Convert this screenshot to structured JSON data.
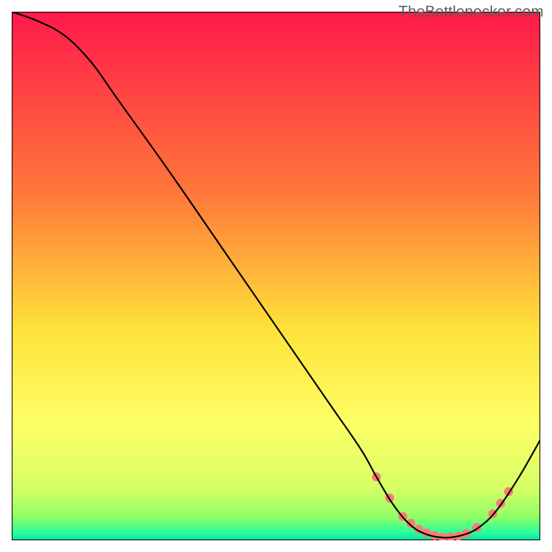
{
  "watermark": "TheBottlenecker.com",
  "chart_data": {
    "type": "line",
    "title": "",
    "xlabel": "",
    "ylabel": "",
    "xlim": [
      0,
      100
    ],
    "ylim": [
      0,
      100
    ],
    "grid": false,
    "legend": false,
    "background_gradient_stops": [
      {
        "offset": 0.0,
        "color": "#ff1a4b"
      },
      {
        "offset": 0.35,
        "color": "#ff7a3a"
      },
      {
        "offset": 0.6,
        "color": "#ffe23a"
      },
      {
        "offset": 0.78,
        "color": "#fdff66"
      },
      {
        "offset": 0.9,
        "color": "#d6ff66"
      },
      {
        "offset": 0.955,
        "color": "#92ff66"
      },
      {
        "offset": 0.985,
        "color": "#2bff9a"
      },
      {
        "offset": 1.0,
        "color": "#00e3a8"
      }
    ],
    "series": [
      {
        "name": "curve",
        "stroke": "#000000",
        "stroke_width": 2.3,
        "points": [
          {
            "x": 0.0,
            "y": 100.0
          },
          {
            "x": 5.0,
            "y": 98.2
          },
          {
            "x": 10.0,
            "y": 95.5
          },
          {
            "x": 15.0,
            "y": 90.5
          },
          {
            "x": 20.0,
            "y": 83.5
          },
          {
            "x": 30.0,
            "y": 69.5
          },
          {
            "x": 40.0,
            "y": 55.0
          },
          {
            "x": 50.0,
            "y": 40.5
          },
          {
            "x": 60.0,
            "y": 26.0
          },
          {
            "x": 66.0,
            "y": 17.3
          },
          {
            "x": 69.0,
            "y": 12.0
          },
          {
            "x": 72.0,
            "y": 7.0
          },
          {
            "x": 75.0,
            "y": 3.3
          },
          {
            "x": 78.0,
            "y": 1.3
          },
          {
            "x": 82.0,
            "y": 0.5
          },
          {
            "x": 86.0,
            "y": 1.2
          },
          {
            "x": 89.0,
            "y": 2.9
          },
          {
            "x": 92.0,
            "y": 6.0
          },
          {
            "x": 96.0,
            "y": 12.0
          },
          {
            "x": 100.0,
            "y": 19.0
          }
        ]
      }
    ],
    "markers": {
      "name": "highlight-dots",
      "fill": "#ff7a72",
      "radius": 6.5,
      "points": [
        {
          "x": 69.0,
          "y": 12.0
        },
        {
          "x": 71.5,
          "y": 8.0
        },
        {
          "x": 74.0,
          "y": 4.5
        },
        {
          "x": 75.5,
          "y": 3.2
        },
        {
          "x": 77.0,
          "y": 2.1
        },
        {
          "x": 78.5,
          "y": 1.4
        },
        {
          "x": 80.0,
          "y": 0.9
        },
        {
          "x": 81.5,
          "y": 0.6
        },
        {
          "x": 83.0,
          "y": 0.6
        },
        {
          "x": 84.5,
          "y": 0.8
        },
        {
          "x": 86.0,
          "y": 1.3
        },
        {
          "x": 88.0,
          "y": 2.4
        },
        {
          "x": 91.0,
          "y": 5.0
        },
        {
          "x": 92.5,
          "y": 7.0
        },
        {
          "x": 94.0,
          "y": 9.2
        }
      ]
    }
  }
}
